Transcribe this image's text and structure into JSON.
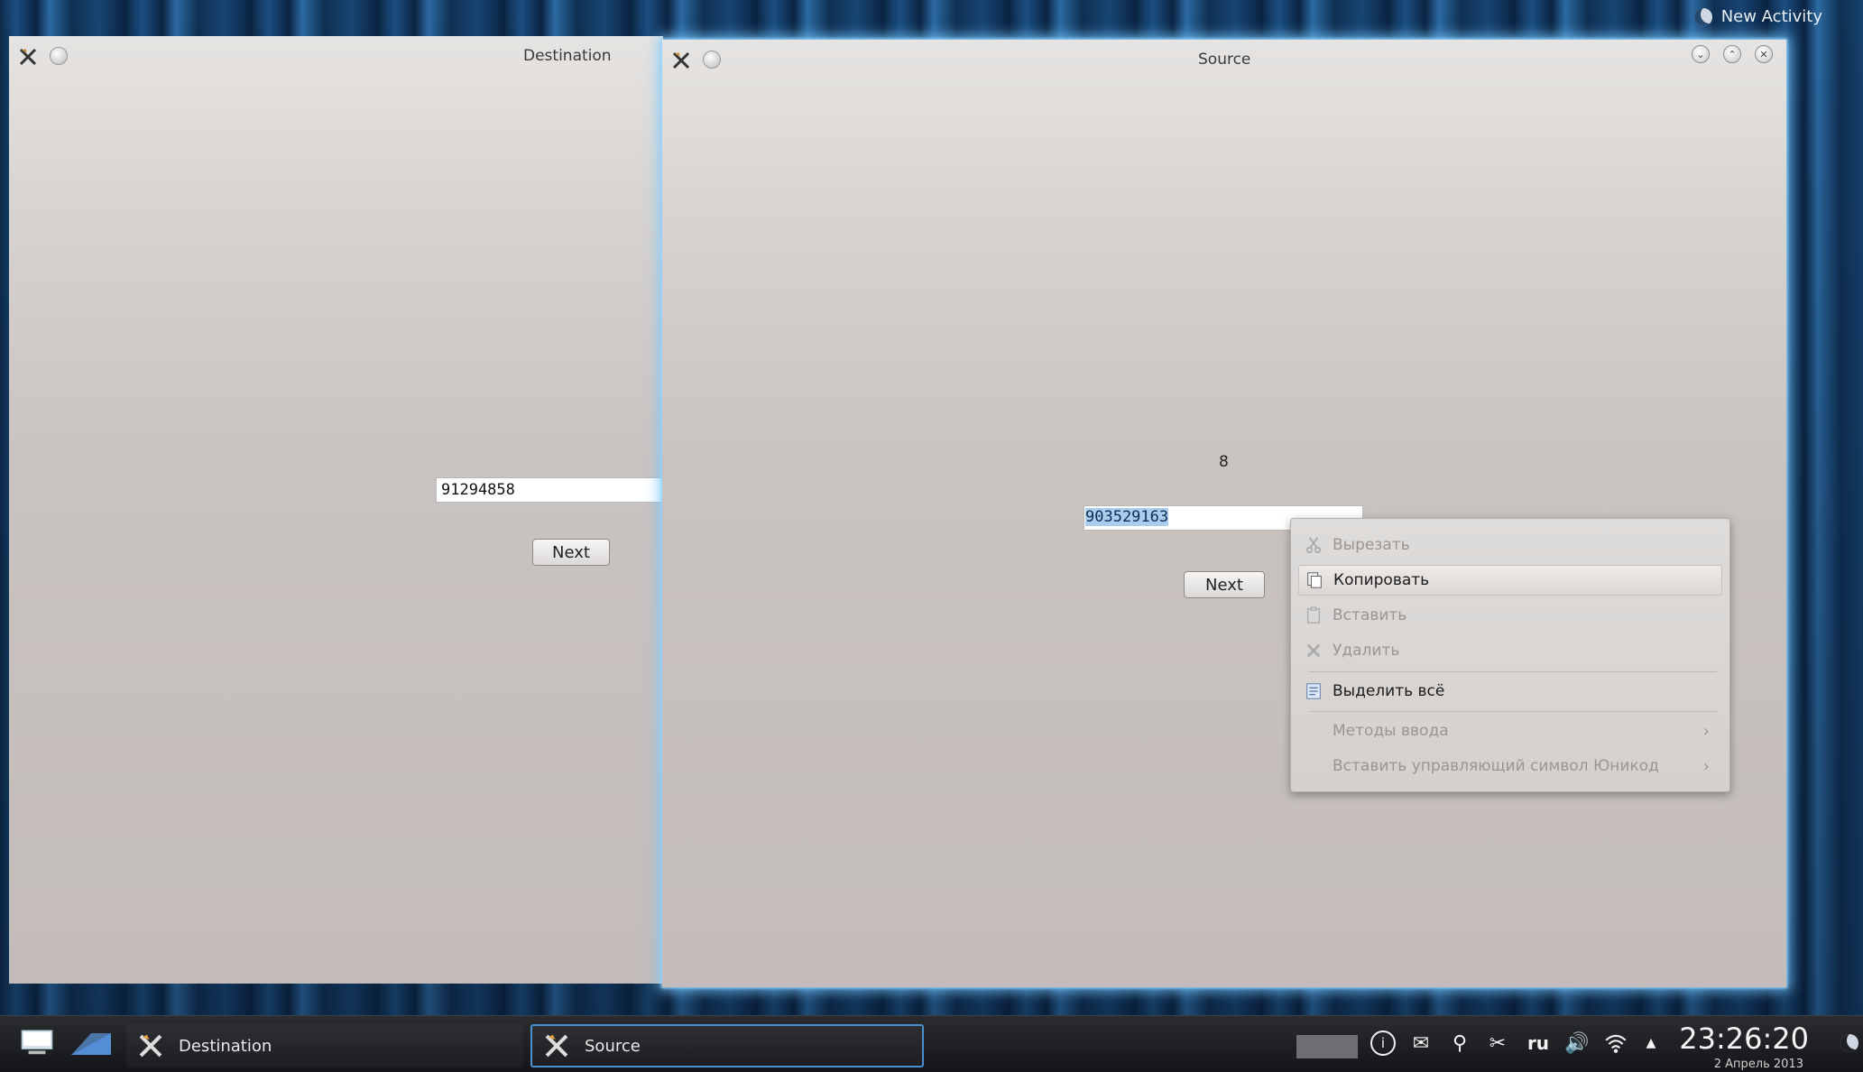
{
  "desktop": {
    "activity_label": "New Activity"
  },
  "destination_window": {
    "title": "Destination",
    "text_value": "91294858",
    "next_label": "Next"
  },
  "source_window": {
    "title": "Source",
    "counter": "8",
    "text_value": "903529163",
    "next_label": "Next"
  },
  "context_menu": {
    "items": [
      {
        "label": "Вырезать",
        "icon": "scissors-icon",
        "enabled": false
      },
      {
        "label": "Копировать",
        "icon": "copy-icon",
        "enabled": true,
        "highlighted": true
      },
      {
        "label": "Вставить",
        "icon": "paste-icon",
        "enabled": false
      },
      {
        "label": "Удалить",
        "icon": "delete-icon",
        "enabled": false
      },
      {
        "label": "Выделить всё",
        "icon": "select-all-icon",
        "enabled": true
      },
      {
        "label": "Методы ввода",
        "enabled": false,
        "submenu": true
      },
      {
        "label": "Вставить управляющий символ Юникод",
        "enabled": false,
        "submenu": true
      }
    ]
  },
  "taskbar": {
    "tasks": [
      {
        "label": "Destination"
      },
      {
        "label": "Source",
        "active": true
      }
    ],
    "tray": {
      "info": "i",
      "language": "ru"
    },
    "clock": {
      "time": "23:26:20",
      "date": "2 Апрель 2013"
    }
  },
  "colors": {
    "selection": "#a9cdea",
    "active_glow": "#78c8ff",
    "taskbar": "#1d1e21"
  }
}
